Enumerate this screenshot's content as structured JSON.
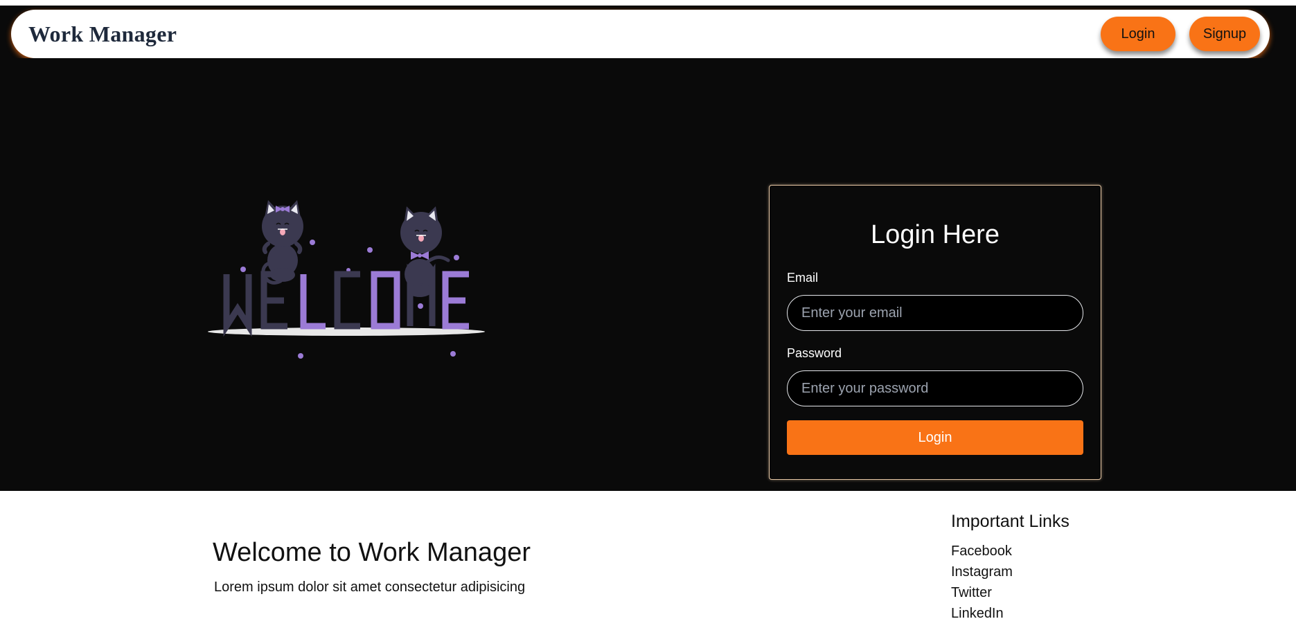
{
  "navbar": {
    "brand": "Work Manager",
    "login_label": "Login",
    "signup_label": "Signup"
  },
  "illustration": {
    "word": "WELCOME",
    "accent_color": "#9b7bd6",
    "dark_color": "#3b3950"
  },
  "login_form": {
    "title": "Login Here",
    "email_label": "Email",
    "email_placeholder": "Enter your email",
    "password_label": "Password",
    "password_placeholder": "Enter your password",
    "submit_label": "Login"
  },
  "footer": {
    "title": "Welcome to Work Manager",
    "text": "Lorem ipsum dolor sit amet consectetur adipisicing",
    "links_title": "Important Links",
    "links": [
      "Facebook",
      "Instagram",
      "Twitter",
      "LinkedIn"
    ]
  },
  "colors": {
    "accent": "#f97316",
    "background": "#0a0a0a",
    "card_border": "#e9c9a6"
  }
}
